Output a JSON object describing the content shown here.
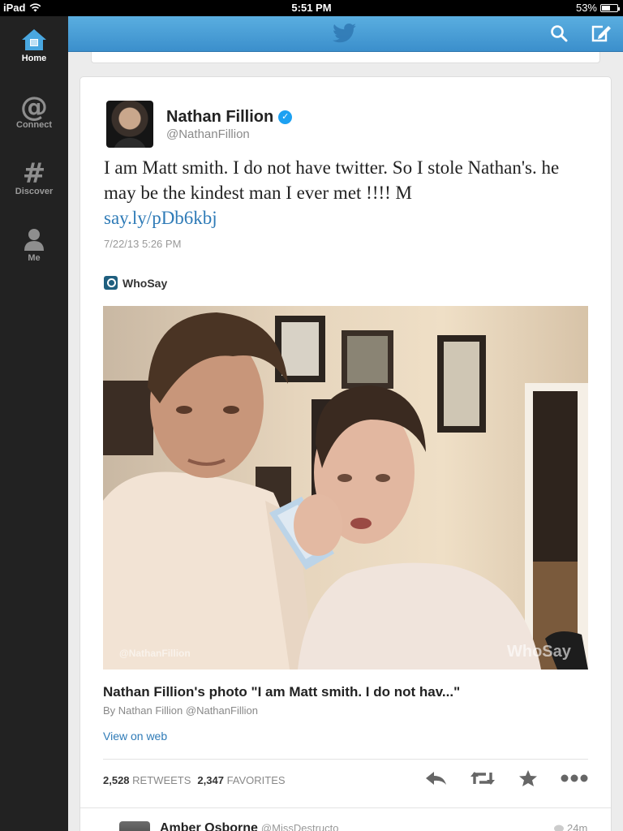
{
  "status_bar": {
    "device": "iPad",
    "time": "5:51 PM",
    "battery": "53%",
    "battery_level": 0.53
  },
  "sidebar": {
    "items": [
      {
        "label": "Home",
        "icon": "home-icon",
        "active": true
      },
      {
        "label": "Connect",
        "icon": "at-icon"
      },
      {
        "label": "Discover",
        "icon": "hash-icon"
      },
      {
        "label": "Me",
        "icon": "person-icon"
      }
    ]
  },
  "topbar": {
    "logo": "twitter-bird-icon",
    "search_icon": "search-icon",
    "compose_icon": "compose-icon"
  },
  "tweet": {
    "author_name": "Nathan Fillion",
    "author_handle": "@NathanFillion",
    "text": "I am Matt smith. I do not have twitter. So I stole Nathan's. he may be the kindest man I ever met !!!! M",
    "link": "say.ly/pDb6kbj",
    "timestamp": "7/22/13 5:26 PM",
    "provider": "WhoSay",
    "media_title": "Nathan Fillion's photo \"I am Matt smith. I do not hav...\"",
    "media_byline": "By Nathan Fillion @NathanFillion",
    "view_on_web": "View on web",
    "photo_watermark": "WhoSay",
    "retweets_count": "2,528",
    "retweets_label": "RETWEETS",
    "favorites_count": "2,347",
    "favorites_label": "FAVORITES"
  },
  "next_tweet": {
    "author_name": "Amber Osborne",
    "author_handle": "@MissDestructo",
    "time": "24m"
  },
  "colors": {
    "accent": "#2f7bb7",
    "topbar": "#4a9fd8",
    "sidebar": "#222222",
    "verified": "#1da1f2"
  }
}
